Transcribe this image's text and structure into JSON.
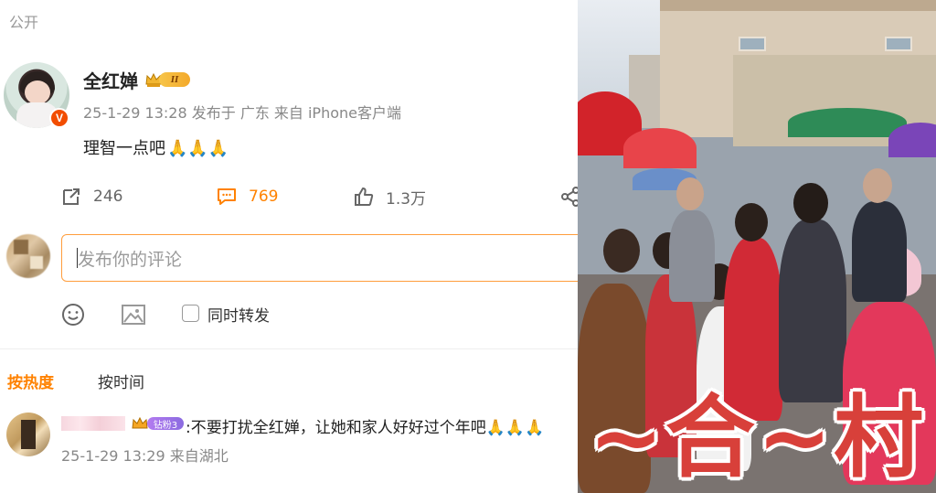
{
  "post": {
    "visibility": "公开",
    "author": {
      "name": "全红婵",
      "verified_mark": "V",
      "level_badge": "II"
    },
    "meta": "25-1-29 13:28 发布于 广东 来自 iPhone客户端",
    "content": "理智一点吧",
    "emoji": "🙏🙏🙏",
    "actions": {
      "repost_count": "246",
      "comment_count": "769",
      "like_count": "1.3万"
    }
  },
  "composer": {
    "placeholder": "发布你的评论",
    "repost_checkbox_label": "同时转发"
  },
  "sort": {
    "hot_label": "按热度",
    "time_label": "按时间"
  },
  "comments": [
    {
      "fan_badge": "钻粉3",
      "text": ":不要打扰全红婵，让她和家人好好过个年吧🙏🙏🙏",
      "meta": "25-1-29 13:29 来自湖北"
    }
  ],
  "image_overlay": {
    "text": "~合~村"
  },
  "colors": {
    "accent": "#ff8200",
    "verified": "#f24d00",
    "input_border": "#ff9d3c",
    "overlay_text": "#d8403a"
  },
  "icons": [
    "repost-icon",
    "comment-icon",
    "like-icon",
    "share-icon",
    "emoji-icon",
    "image-icon",
    "crown-icon"
  ]
}
